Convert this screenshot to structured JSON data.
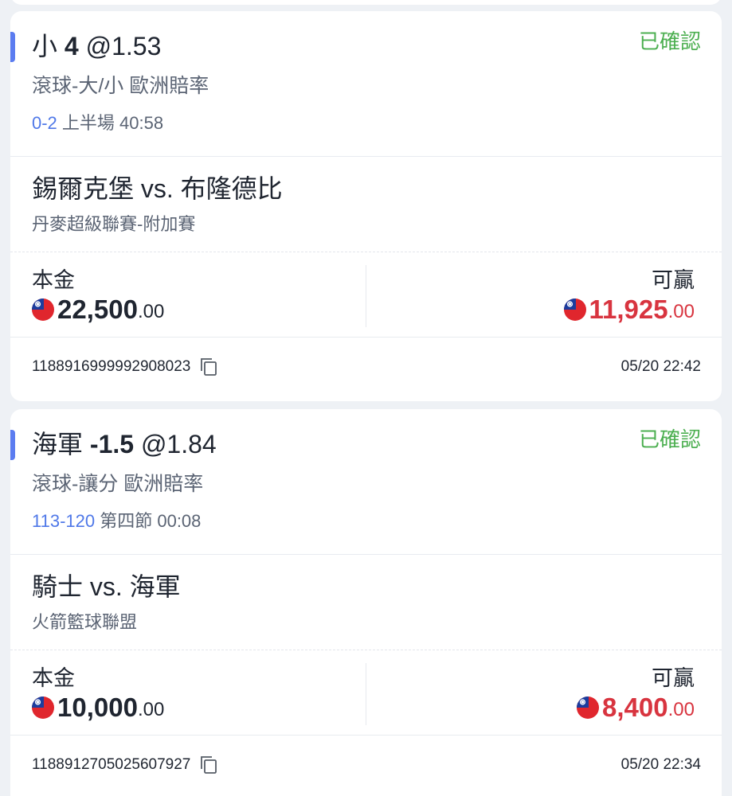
{
  "colors": {
    "accent": "#5b7cf0",
    "confirmed": "#4caf50",
    "score": "#4f78e8",
    "win": "#d8343f",
    "background": "#eef1f5"
  },
  "bets": [
    {
      "pick_name": "小",
      "pick_line": "4",
      "odds": "@1.53",
      "status": "已確認",
      "market": "滾球-大/小 歐洲賠率",
      "score": "0-2",
      "period": "上半場 40:58",
      "teams": "錫爾克堡 vs. 布隆德比",
      "league": "丹麥超級聯賽-附加賽",
      "stake_label": "本金",
      "stake_int": "22,500",
      "stake_dec": ".00",
      "win_label": "可贏",
      "win_int": "11,925",
      "win_dec": ".00",
      "order_id": "1188916999992908023",
      "time": "05/20 22:42",
      "flag_icon": "taiwan-flag-icon",
      "copy_icon": "copy-icon"
    },
    {
      "pick_name": "海軍",
      "pick_line": "-1.5",
      "odds": "@1.84",
      "status": "已確認",
      "market": "滾球-讓分 歐洲賠率",
      "score": "113-120",
      "period": "第四節 00:08",
      "teams": "騎士 vs. 海軍",
      "league": "火箭籃球聯盟",
      "stake_label": "本金",
      "stake_int": "10,000",
      "stake_dec": ".00",
      "win_label": "可贏",
      "win_int": "8,400",
      "win_dec": ".00",
      "order_id": "1188912705025607927",
      "time": "05/20 22:34",
      "flag_icon": "taiwan-flag-icon",
      "copy_icon": "copy-icon"
    }
  ]
}
